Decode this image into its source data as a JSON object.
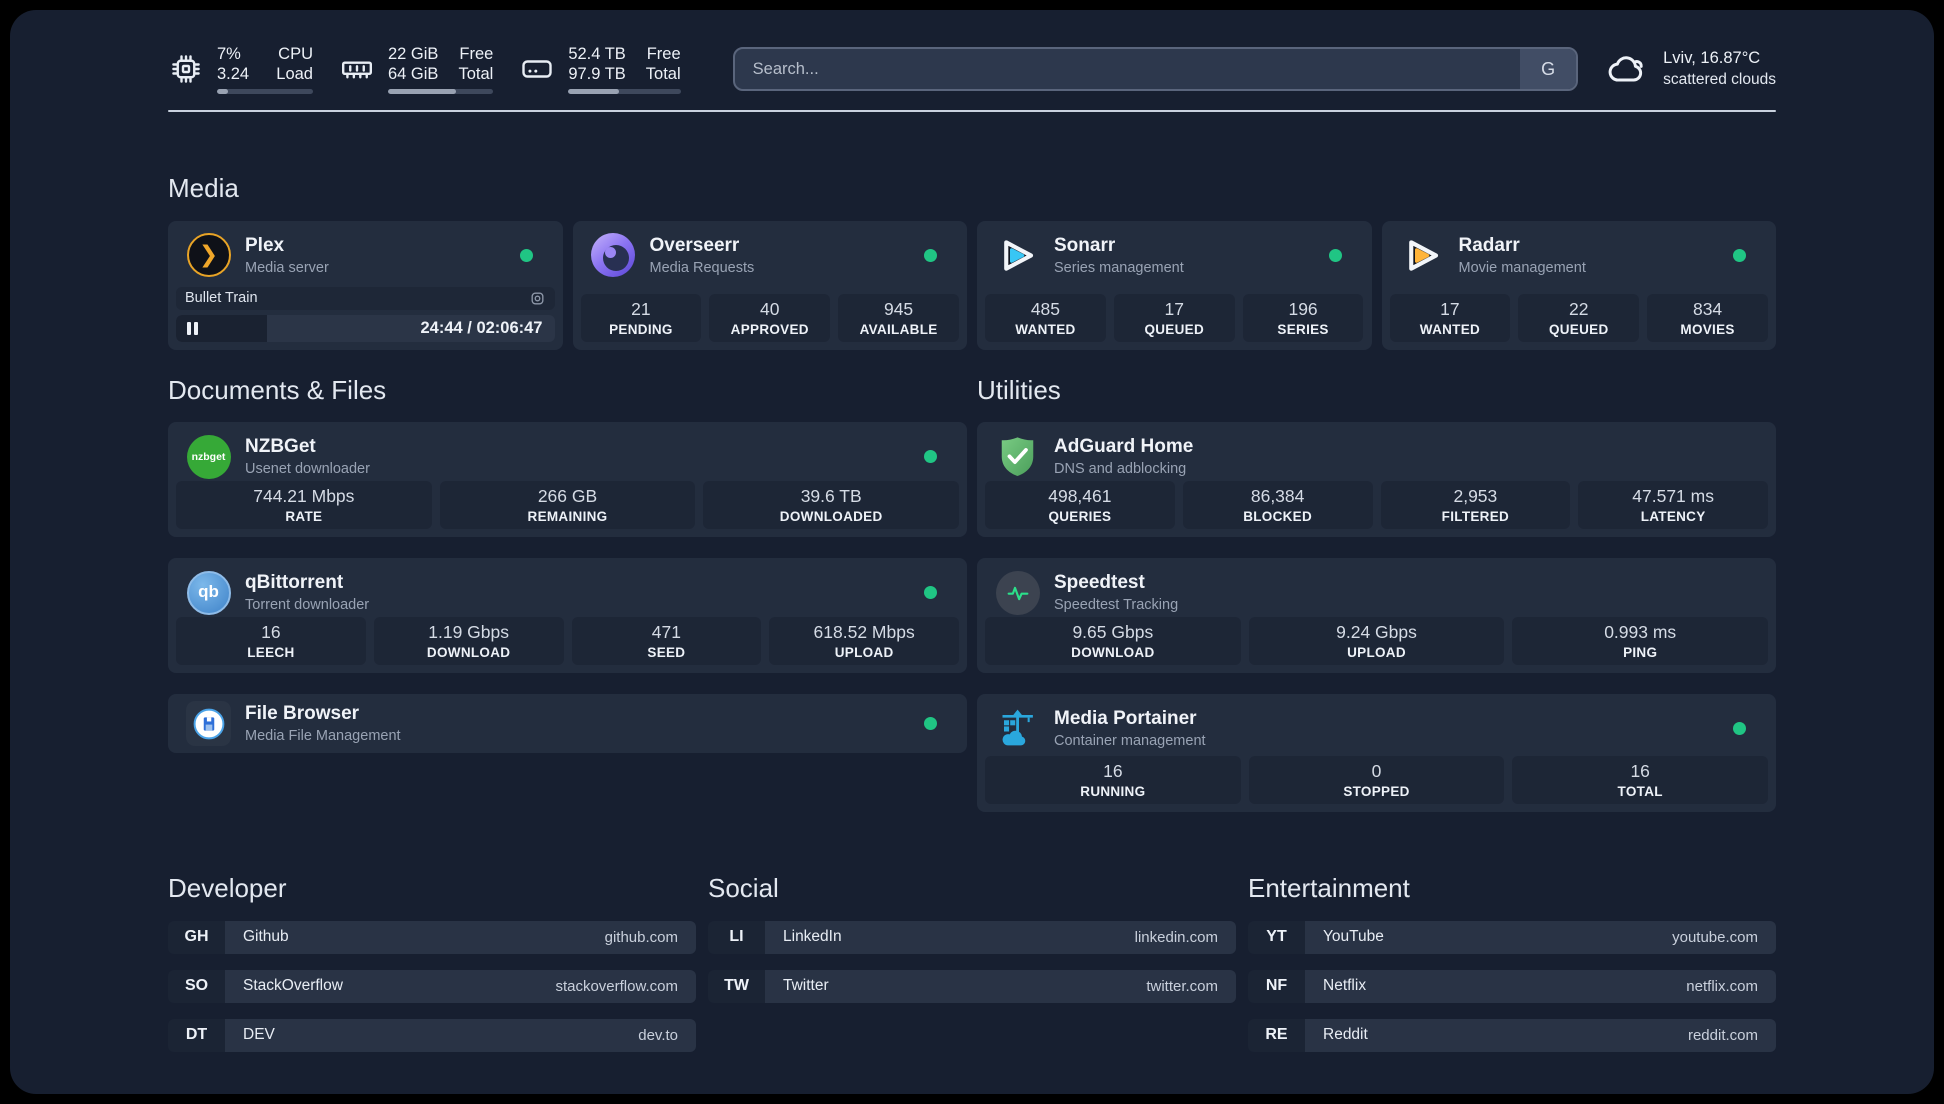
{
  "topbar": {
    "stats": [
      {
        "icon": "cpu-icon",
        "value1": "7%",
        "value2": "3.24",
        "label1": "CPU",
        "label2": "Load",
        "percent": 11
      },
      {
        "icon": "ram-icon",
        "value1": "22 GiB",
        "value2": "64 GiB",
        "label1": "Free",
        "label2": "Total",
        "percent": 65
      },
      {
        "icon": "disk-icon",
        "value1": "52.4 TB",
        "value2": "97.9 TB",
        "label1": "Free",
        "label2": "Total",
        "percent": 45
      }
    ],
    "search": {
      "placeholder": "Search...",
      "button": "G"
    },
    "weather": {
      "line1": "Lviv, 16.87°C",
      "line2": "scattered clouds"
    }
  },
  "sections": {
    "media": {
      "title": "Media"
    },
    "documents": {
      "title": "Documents & Files"
    },
    "utilities": {
      "title": "Utilities"
    },
    "developer": {
      "title": "Developer"
    },
    "social": {
      "title": "Social"
    },
    "entertainment": {
      "title": "Entertainment"
    }
  },
  "apps": {
    "plex": {
      "name": "Plex",
      "desc": "Media server",
      "status": "online",
      "now_playing": {
        "title": "Bullet Train",
        "time": "24:44 / 02:06:47",
        "percent": 24
      }
    },
    "overseerr": {
      "name": "Overseerr",
      "desc": "Media Requests",
      "status": "online",
      "stats": [
        {
          "value": "21",
          "label": "PENDING"
        },
        {
          "value": "40",
          "label": "APPROVED"
        },
        {
          "value": "945",
          "label": "AVAILABLE"
        }
      ]
    },
    "sonarr": {
      "name": "Sonarr",
      "desc": "Series management",
      "status": "online",
      "stats": [
        {
          "value": "485",
          "label": "WANTED"
        },
        {
          "value": "17",
          "label": "QUEUED"
        },
        {
          "value": "196",
          "label": "SERIES"
        }
      ]
    },
    "radarr": {
      "name": "Radarr",
      "desc": "Movie management",
      "status": "online",
      "stats": [
        {
          "value": "17",
          "label": "WANTED"
        },
        {
          "value": "22",
          "label": "QUEUED"
        },
        {
          "value": "834",
          "label": "MOVIES"
        }
      ]
    },
    "nzbget": {
      "name": "NZBGet",
      "desc": "Usenet downloader",
      "status": "online",
      "icon_text": "nzbget",
      "stats": [
        {
          "value": "744.21 Mbps",
          "label": "RATE"
        },
        {
          "value": "266 GB",
          "label": "REMAINING"
        },
        {
          "value": "39.6 TB",
          "label": "DOWNLOADED"
        }
      ]
    },
    "qbittorrent": {
      "name": "qBittorrent",
      "desc": "Torrent downloader",
      "status": "online",
      "icon_text": "qb",
      "stats": [
        {
          "value": "16",
          "label": "LEECH"
        },
        {
          "value": "1.19 Gbps",
          "label": "DOWNLOAD"
        },
        {
          "value": "471",
          "label": "SEED"
        },
        {
          "value": "618.52 Mbps",
          "label": "UPLOAD"
        }
      ]
    },
    "filebrowser": {
      "name": "File Browser",
      "desc": "Media File Management",
      "status": "online"
    },
    "adguard": {
      "name": "AdGuard Home",
      "desc": "DNS and adblocking",
      "stats": [
        {
          "value": "498,461",
          "label": "QUERIES"
        },
        {
          "value": "86,384",
          "label": "BLOCKED"
        },
        {
          "value": "2,953",
          "label": "FILTERED"
        },
        {
          "value": "47.571 ms",
          "label": "LATENCY"
        }
      ]
    },
    "speedtest": {
      "name": "Speedtest",
      "desc": "Speedtest Tracking",
      "stats": [
        {
          "value": "9.65 Gbps",
          "label": "DOWNLOAD"
        },
        {
          "value": "9.24 Gbps",
          "label": "UPLOAD"
        },
        {
          "value": "0.993 ms",
          "label": "PING"
        }
      ]
    },
    "portainer": {
      "name": "Media Portainer",
      "desc": "Container management",
      "status": "online",
      "stats": [
        {
          "value": "16",
          "label": "RUNNING"
        },
        {
          "value": "0",
          "label": "STOPPED"
        },
        {
          "value": "16",
          "label": "TOTAL"
        }
      ]
    }
  },
  "links": {
    "developer": [
      {
        "abbr": "GH",
        "name": "Github",
        "url": "github.com"
      },
      {
        "abbr": "SO",
        "name": "StackOverflow",
        "url": "stackoverflow.com"
      },
      {
        "abbr": "DT",
        "name": "DEV",
        "url": "dev.to"
      }
    ],
    "social": [
      {
        "abbr": "LI",
        "name": "LinkedIn",
        "url": "linkedin.com"
      },
      {
        "abbr": "TW",
        "name": "Twitter",
        "url": "twitter.com"
      }
    ],
    "entertainment": [
      {
        "abbr": "YT",
        "name": "YouTube",
        "url": "youtube.com"
      },
      {
        "abbr": "NF",
        "name": "Netflix",
        "url": "netflix.com"
      },
      {
        "abbr": "RE",
        "name": "Reddit",
        "url": "reddit.com"
      }
    ]
  },
  "colors": {
    "online": "#20C584",
    "plex_gold": "#E9A426"
  }
}
